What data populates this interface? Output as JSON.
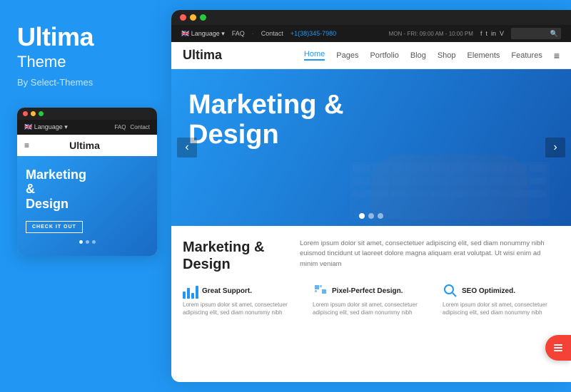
{
  "left": {
    "title": "Ultima",
    "subtitle": "Theme",
    "byline": "By Select-Themes"
  },
  "mobile": {
    "topnav": {
      "language": "🇬🇧 Language ▾",
      "links": [
        "FAQ",
        "Contact"
      ]
    },
    "header": {
      "logo": "Ultima",
      "hamburger": "≡"
    },
    "hero": {
      "title": "Marketing &\nDesign",
      "btn_label": "CHECK IT OUT"
    },
    "dots": [
      "active",
      "",
      ""
    ]
  },
  "desktop": {
    "topnav": {
      "language": "🇬🇧 Language ▾",
      "links": [
        "FAQ",
        "Contact"
      ],
      "hours": "MON - FRI: 09:00 AM - 10:00 PM",
      "phone": "+1(38)345-7980",
      "social": [
        "f",
        "t",
        "in",
        "V"
      ]
    },
    "header": {
      "logo": "Ultima",
      "menu": [
        {
          "label": "Home",
          "active": true
        },
        {
          "label": "Pages"
        },
        {
          "label": "Portfolio"
        },
        {
          "label": "Blog"
        },
        {
          "label": "Shop"
        },
        {
          "label": "Elements"
        },
        {
          "label": "Features"
        }
      ],
      "hamburger": "≡"
    },
    "hero": {
      "title": "Marketing &\nDesign",
      "dots": [
        "active",
        "",
        ""
      ]
    },
    "content": {
      "heading": "Marketing &\nDesign",
      "text": "Lorem ipsum dolor sit amet, consectetuer adipiscing elit, sed diam nonummy nibh euismod tincidunt ut laoreet dolore magna aliquam erat volutpat. Ut wisi enim ad minim veniam",
      "features": [
        {
          "icon_type": "bar",
          "title": "Great Support.",
          "text": "Lorem ipsum dolor sit amet, consectetuer adipiscing elit, sed diam nonummy nibh"
        },
        {
          "icon_type": "pixel",
          "title": "Pixel-Perfect Design.",
          "text": "Lorem ipsum dolor sit amet, consectetuer adipiscing elit, sed diam nonummy nibh"
        },
        {
          "icon_type": "seo",
          "title": "SEO Optimized.",
          "text": "Lorem ipsum dolor sit amet, consectetuer adipiscing elit, sed diam nonummy nibh"
        }
      ]
    }
  },
  "topbar_dots": {
    "red": "#ff5f57",
    "yellow": "#febc2e",
    "green": "#28c840"
  },
  "accent_color": "#2196F3",
  "floating_btn_icon": "☰"
}
